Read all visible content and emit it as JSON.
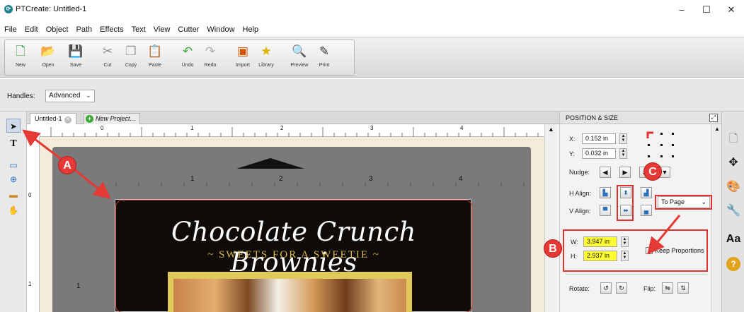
{
  "window": {
    "title": "PTCreate: Untitled-1",
    "app_icon": "PTCreate-logo-icon",
    "minimize": "–",
    "maximize": "☐",
    "close": "✕"
  },
  "menu": [
    "File",
    "Edit",
    "Object",
    "Path",
    "Effects",
    "Text",
    "View",
    "Cutter",
    "Window",
    "Help"
  ],
  "toolbar": [
    {
      "label": "New",
      "icon": "new-doc-icon"
    },
    {
      "label": "Open",
      "icon": "open-folder-icon"
    },
    {
      "label": "Save",
      "icon": "save-disk-icon"
    },
    {
      "label": "Cut",
      "icon": "scissors-icon"
    },
    {
      "label": "Copy",
      "icon": "copy-icon"
    },
    {
      "label": "Paste",
      "icon": "paste-icon"
    },
    {
      "label": "Undo",
      "icon": "undo-icon"
    },
    {
      "label": "Redo",
      "icon": "redo-icon"
    },
    {
      "label": "Import",
      "icon": "svg-import-icon"
    },
    {
      "label": "Library",
      "icon": "library-star-icon"
    },
    {
      "label": "Preview",
      "icon": "magnifier-preview-icon"
    },
    {
      "label": "Print",
      "icon": "print-pen-icon"
    }
  ],
  "options": {
    "handles_label": "Handles:",
    "handles_value": "Advanced"
  },
  "tabs": [
    {
      "label": "Untitled-1"
    },
    {
      "label": "New Project..."
    }
  ],
  "rulers": {
    "top": [
      "0",
      "1",
      "2",
      "3",
      "4"
    ],
    "left": [
      "0",
      "1"
    ],
    "mat_top": [
      "1",
      "2",
      "3",
      "4"
    ],
    "mat_left": [
      "1"
    ]
  },
  "poster": {
    "title": "Chocolate Crunch Brownies",
    "subtitle": "~ SWEETS FOR A SWEETIE ~"
  },
  "panel": {
    "header": "POSITION & SIZE",
    "x_label": "X:",
    "x_value": "0.152 in",
    "y_label": "Y:",
    "y_value": "0.032 in",
    "nudge_label": "Nudge:",
    "h_align_label": "H Align:",
    "v_align_label": "V Align:",
    "align_target": "To Page",
    "w_label": "W:",
    "w_value": "3.947 in",
    "h_label": "H:",
    "h_value": "2.937 in",
    "keep_proportions": "Keep Proportions",
    "keep_proportions_checked": false,
    "rotate_label": "Rotate:",
    "flip_label": "Flip:"
  },
  "callouts": {
    "a": "A",
    "b": "B",
    "c": "C"
  },
  "colors": {
    "callout_red": "#e53935",
    "highlight_yellow": "#ffff33",
    "poster_gold": "#d9b74a"
  }
}
